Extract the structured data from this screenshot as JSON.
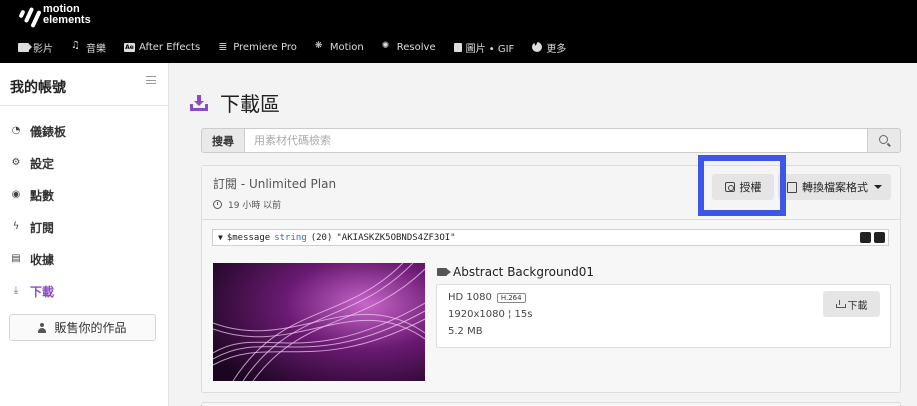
{
  "brand": {
    "line1": "motion",
    "line2": "elements"
  },
  "nav": [
    {
      "label": "影片",
      "icon": "video-icon"
    },
    {
      "label": "音樂",
      "icon": "music-icon"
    },
    {
      "label": "After Effects",
      "icon": "after-effects-icon"
    },
    {
      "label": "Premiere Pro",
      "icon": "premiere-pro-icon"
    },
    {
      "label": "Motion",
      "icon": "motion-icon"
    },
    {
      "label": "Resolve",
      "icon": "resolve-icon"
    },
    {
      "label": "圖片 • GIF",
      "icon": "image-icon"
    },
    {
      "label": "更多",
      "icon": "more-icon"
    }
  ],
  "sidebar": {
    "title": "我的帳號",
    "items": [
      {
        "label": "儀錶板",
        "icon": "dashboard-icon"
      },
      {
        "label": "設定",
        "icon": "gear-icon"
      },
      {
        "label": "點數",
        "icon": "points-icon"
      },
      {
        "label": "訂閱",
        "icon": "subscription-icon"
      },
      {
        "label": "收據",
        "icon": "receipt-icon"
      },
      {
        "label": "下載",
        "icon": "download-icon"
      }
    ],
    "active_index": 5,
    "sell_label": "販售你的作品"
  },
  "page": {
    "title": "下載區"
  },
  "search": {
    "label": "搜尋",
    "placeholder": "用素材代碼檢索"
  },
  "download": {
    "plan": "訂閱 - Unlimited Plan",
    "time": "19 小時 以前",
    "license_label": "授權",
    "convert_label": "轉換檔案格式",
    "debug": {
      "var": "$message",
      "type": "string",
      "len": "(20)",
      "value": "\"AKIASKZK5OBNDS4ZF3OI\""
    },
    "asset": {
      "title": "Abstract Background01",
      "quality": "HD 1080",
      "codec": "H.264",
      "dimensions": "1920x1080 ¦ 15s",
      "size": "5.2 MB",
      "download_label": "下載"
    }
  },
  "colors": {
    "accent": "#8a4cc4",
    "highlight": "#3d55e8",
    "header": "#000000"
  }
}
